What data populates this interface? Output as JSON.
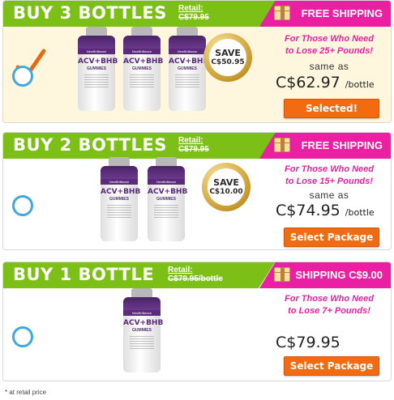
{
  "packages": [
    {
      "title": "BUY 3 BOTTLES",
      "retail_label": "Retail:",
      "retail_value": "C$79.95",
      "shipping": "FREE SHIPPING",
      "save_label": "SAVE",
      "save_amount": "C$50.95",
      "tagline_1": "For Those Who Need",
      "tagline_2": "to Lose 25+ Pounds!",
      "same_as": "same as",
      "price": "C$62.97",
      "per": "/bottle",
      "button": "Selected!"
    },
    {
      "title": "BUY 2 BOTTLES",
      "retail_label": "Retail:",
      "retail_value": "C$79.95",
      "shipping": "FREE SHIPPING",
      "save_label": "SAVE",
      "save_amount": "C$10.00",
      "tagline_1": "For Those Who Need",
      "tagline_2": "to Lose 15+ Pounds!",
      "same_as": "same as",
      "price": "C$74.95",
      "per": "/bottle",
      "button": "Select Package"
    },
    {
      "title": "BUY 1 BOTTLE",
      "retail_label": "Retail:",
      "retail_value": "C$79.95/bottle",
      "shipping": "SHIPPING C$9.00",
      "tagline_1": "For Those Who Need",
      "tagline_2": "to Lose 7+ Pounds!",
      "price": "C$79.95",
      "button": "Select Package"
    }
  ],
  "bottle": {
    "brand": "NewBrilliance",
    "name": "ACV+BHB",
    "sub": "GUMMIES"
  },
  "footnote": "* at retail price",
  "colors": {
    "header_green": "#7cbf16",
    "header_pink": "#ea1fa2",
    "button_orange": "#f26b10",
    "radio_blue": "#3fa9dd",
    "check_orange": "#e86a10",
    "selected_bg": "#fff7dd"
  }
}
